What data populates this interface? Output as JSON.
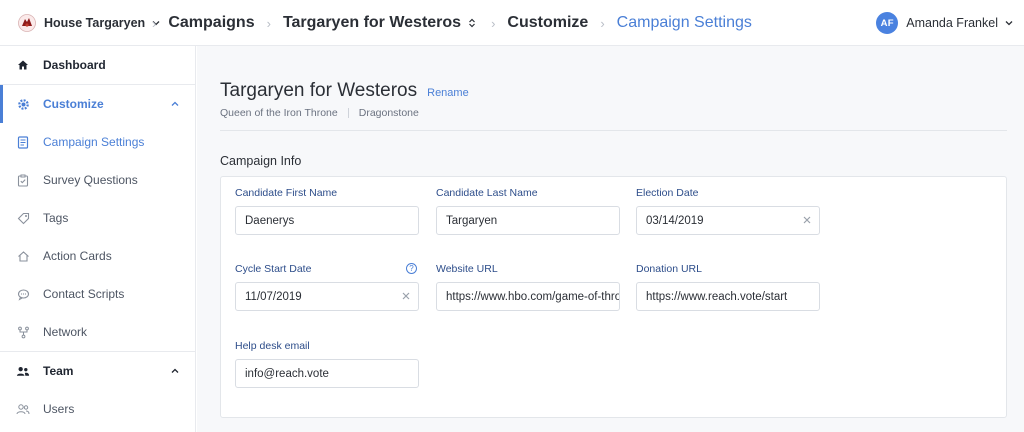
{
  "topbar": {
    "org": "House Targaryen",
    "crumbs": [
      "Campaigns",
      "Targaryen for Westeros",
      "Customize",
      "Campaign Settings"
    ],
    "user": {
      "initials": "AF",
      "name": "Amanda Frankel"
    }
  },
  "sidebar": {
    "items": [
      {
        "label": "Dashboard",
        "icon": "home-icon"
      },
      {
        "label": "Customize",
        "icon": "gear-icon"
      },
      {
        "label": "Campaign Settings",
        "icon": "document-icon"
      },
      {
        "label": "Survey Questions",
        "icon": "clipboard-icon"
      },
      {
        "label": "Tags",
        "icon": "tag-icon"
      },
      {
        "label": "Action Cards",
        "icon": "house-outline-icon"
      },
      {
        "label": "Contact Scripts",
        "icon": "chat-icon"
      },
      {
        "label": "Network",
        "icon": "network-icon"
      },
      {
        "label": "Team",
        "icon": "team-icon"
      },
      {
        "label": "Users",
        "icon": "users-icon"
      }
    ]
  },
  "main": {
    "title": "Targaryen for Westeros",
    "rename_label": "Rename",
    "subtitle": [
      "Queen of the Iron Throne",
      "Dragonstone"
    ],
    "section_title": "Campaign Info",
    "fields": {
      "first_name": {
        "label": "Candidate First Name",
        "value": "Daenerys"
      },
      "last_name": {
        "label": "Candidate Last Name",
        "value": "Targaryen"
      },
      "election_date": {
        "label": "Election Date",
        "value": "03/14/2019"
      },
      "cycle_start": {
        "label": "Cycle Start Date",
        "value": "11/07/2019",
        "help": "?"
      },
      "website": {
        "label": "Website URL",
        "value": "https://www.hbo.com/game-of-thrones"
      },
      "donation": {
        "label": "Donation URL",
        "value": "https://www.reach.vote/start"
      },
      "help_email": {
        "label": "Help desk email",
        "value": "info@reach.vote"
      }
    }
  },
  "colors": {
    "accent": "#4a7fd6",
    "label": "#2d4d8a"
  }
}
